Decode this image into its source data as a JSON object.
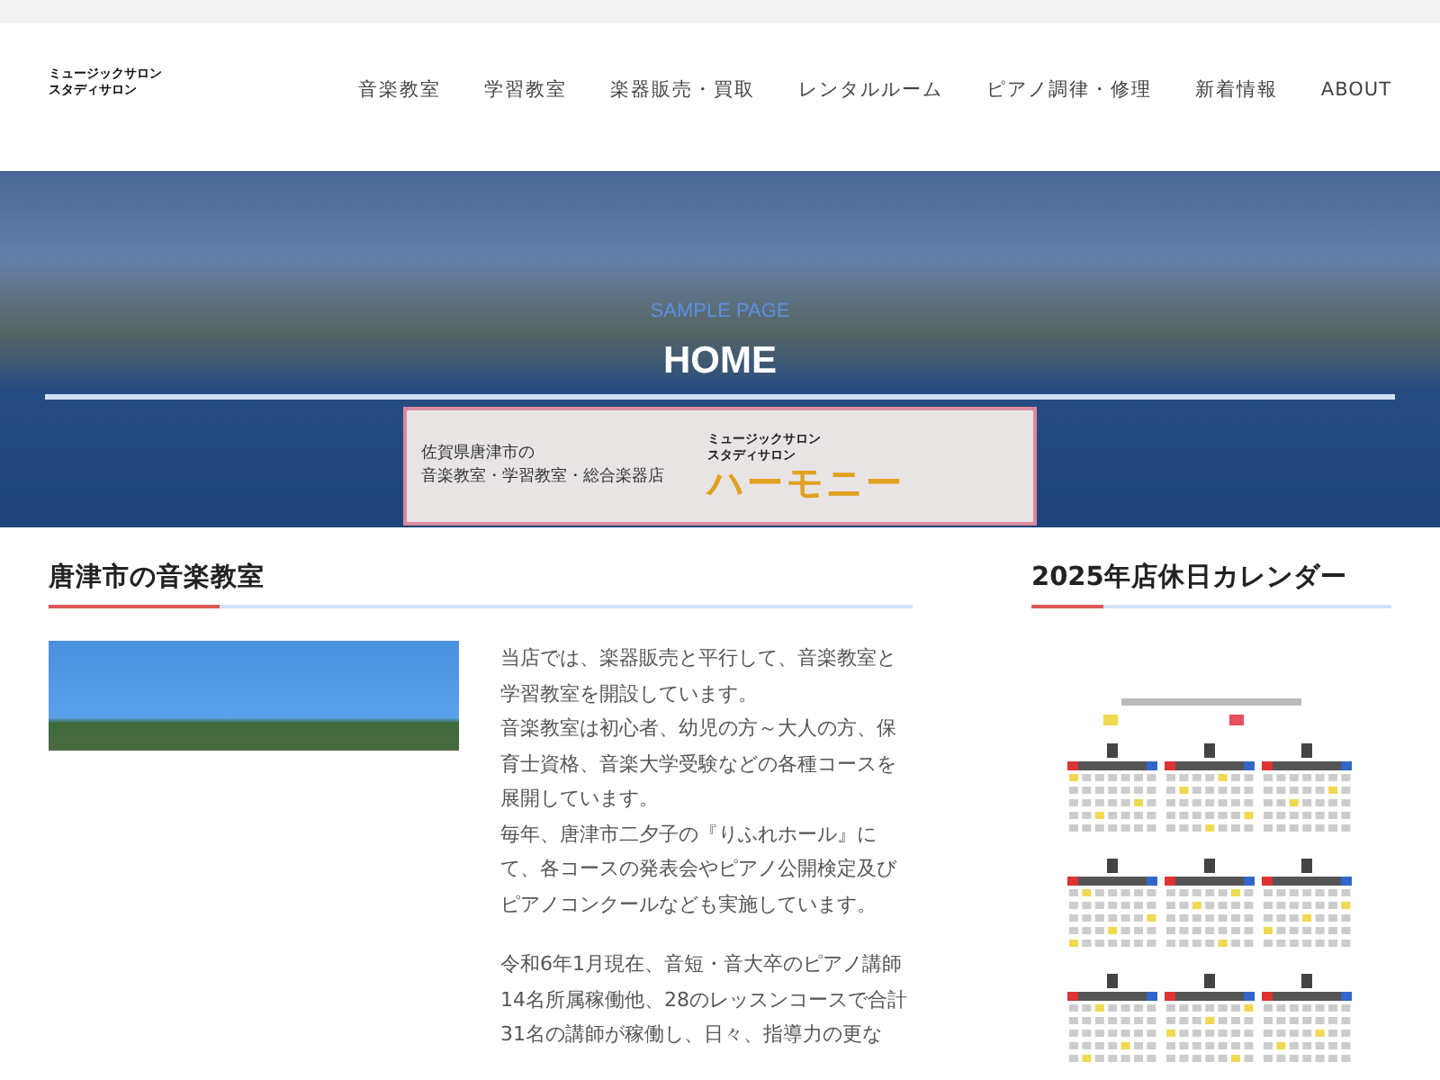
{
  "logo": {
    "line_1": "ミュージックサロン",
    "line_2": "スタディサロン"
  },
  "nav": [
    {
      "label": "音楽教室"
    },
    {
      "label": "学習教室"
    },
    {
      "label": "楽器販売・買取"
    },
    {
      "label": "レンタルルーム"
    },
    {
      "label": "ピアノ調律・修理"
    },
    {
      "label": "新着情報"
    },
    {
      "label": "ABOUT"
    }
  ],
  "hero": {
    "subtitle": "SAMPLE PAGE",
    "title": "HOME",
    "banner": {
      "line_1": "佐賀県唐津市の",
      "line_2": "音楽教室・学習教室・総合楽器店",
      "logo_line_1": "ミュージックサロン",
      "logo_line_2": "スタディサロン",
      "logo_name": "ハーモニー"
    }
  },
  "main": {
    "heading": "唐津市の音楽教室",
    "paragraphs": [
      "当店では、楽器販売と平行して、音楽教室と学習教室を開設しています。",
      "音楽教室は初心者、幼児の方～大人の方、保育士資格、音楽大学受験などの各種コースを展開しています。",
      "毎年、唐津市二夕子の『りふれホール』にて、各コースの発表会やピアノ公開検定及びピアノコンクールなども実施しています。",
      "令和6年1月現在、音短・音大卒のピアノ講師14名所属稼働他、28のレッスンコースで合計31名の講師が稼働し、日々、指導力の更な"
    ]
  },
  "sidebar": {
    "heading": "2025年店休日カレンダー"
  }
}
